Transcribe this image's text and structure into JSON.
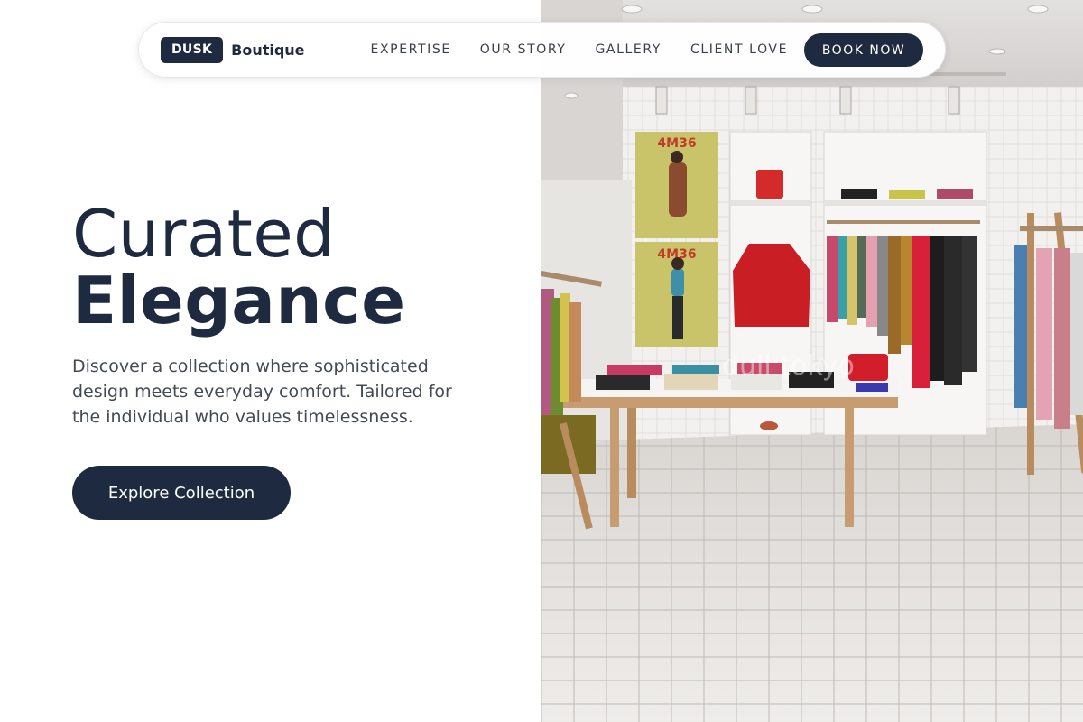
{
  "brand": {
    "badge": "DUSK",
    "name": "Boutique"
  },
  "nav": {
    "links": [
      "EXPERTISE",
      "OUR STORY",
      "GALLERY",
      "CLIENT LOVE"
    ],
    "cta": "BOOK NOW"
  },
  "hero": {
    "title_line1": "Curated",
    "title_line2": "Elegance",
    "description": "Discover a collection where sophisticated design meets everyday comfort. Tailored for the individual who values timelessness.",
    "cta": "Explore Collection"
  },
  "photo": {
    "poster_text": "4M36",
    "watermark": "dull tokyo"
  },
  "colors": {
    "primary": "#1e2a3f",
    "text_muted": "#444a54",
    "nav_text": "#3a3f48"
  }
}
